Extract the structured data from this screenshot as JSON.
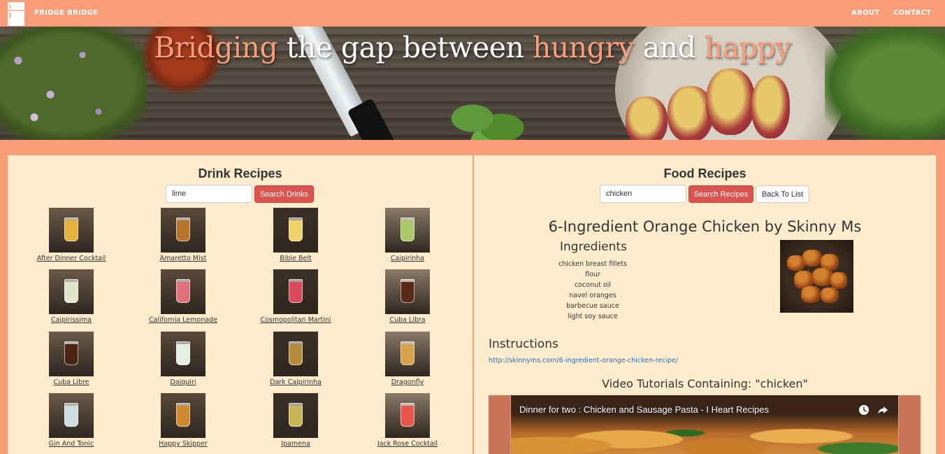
{
  "nav": {
    "brand": "FRIDGE BRIDGE",
    "about": "ABOUT",
    "contact": "CONTACT"
  },
  "hero": {
    "words": [
      "Bridging",
      " the gap between ",
      "hungry",
      " and ",
      "happy"
    ]
  },
  "drinks": {
    "title": "Drink Recipes",
    "search_value": "lime",
    "search_button": "Search Drinks",
    "items": [
      {
        "name": "After Dinner Cocktail",
        "color": "#e8b23a"
      },
      {
        "name": "Amaretto Mist",
        "color": "#b8742a"
      },
      {
        "name": "Bible Belt",
        "color": "#f2d36a"
      },
      {
        "name": "Caipirinha",
        "color": "#a9c86a"
      },
      {
        "name": "Caipirissima",
        "color": "#dfe6c8"
      },
      {
        "name": "California Lemonade",
        "color": "#e0707a"
      },
      {
        "name": "Cosmopolitan Martini",
        "color": "#d9495a"
      },
      {
        "name": "Cuba Libra",
        "color": "#5a2a14"
      },
      {
        "name": "Cuba Libre",
        "color": "#4a2412"
      },
      {
        "name": "Daiquiri",
        "color": "#e6efe4"
      },
      {
        "name": "Dark Caipirinha",
        "color": "#b98a3a"
      },
      {
        "name": "Dragonfly",
        "color": "#d9a24a"
      },
      {
        "name": "Gin And Tonic",
        "color": "#cfdde2"
      },
      {
        "name": "Happy Skipper",
        "color": "#d08a2e"
      },
      {
        "name": "Ipamena",
        "color": "#c9b45a"
      },
      {
        "name": "Jack Rose Cocktail",
        "color": "#e8564a"
      }
    ]
  },
  "food": {
    "title": "Food Recipes",
    "search_value": "chicken",
    "search_button": "Search Recipes",
    "back_button": "Back To List",
    "recipe_title": "6-Ingredient Orange Chicken by Skinny Ms",
    "ingredients_heading": "Ingredients",
    "ingredients": [
      "chicken breast fillets",
      "flour",
      "coconut oil",
      "navel oranges",
      "barbecue sauce",
      "light soy sauce"
    ],
    "instructions_heading": "Instructions",
    "instructions_link": "http://skinnyms.com/6-ingredient-orange-chicken-recipe/",
    "video_heading": "Video Tutorials Containing: \"chicken\"",
    "video_title": "Dinner for two : Chicken and Sausage Pasta - I Heart Recipes"
  },
  "colors": {
    "accent": "#fa9e7a",
    "panel": "#ffeccd",
    "button_red": "#d9534f",
    "link": "#2a6fbd"
  },
  "icons": {
    "logo": "fridge-icon",
    "watch_later": "clock-icon",
    "share": "share-icon"
  }
}
